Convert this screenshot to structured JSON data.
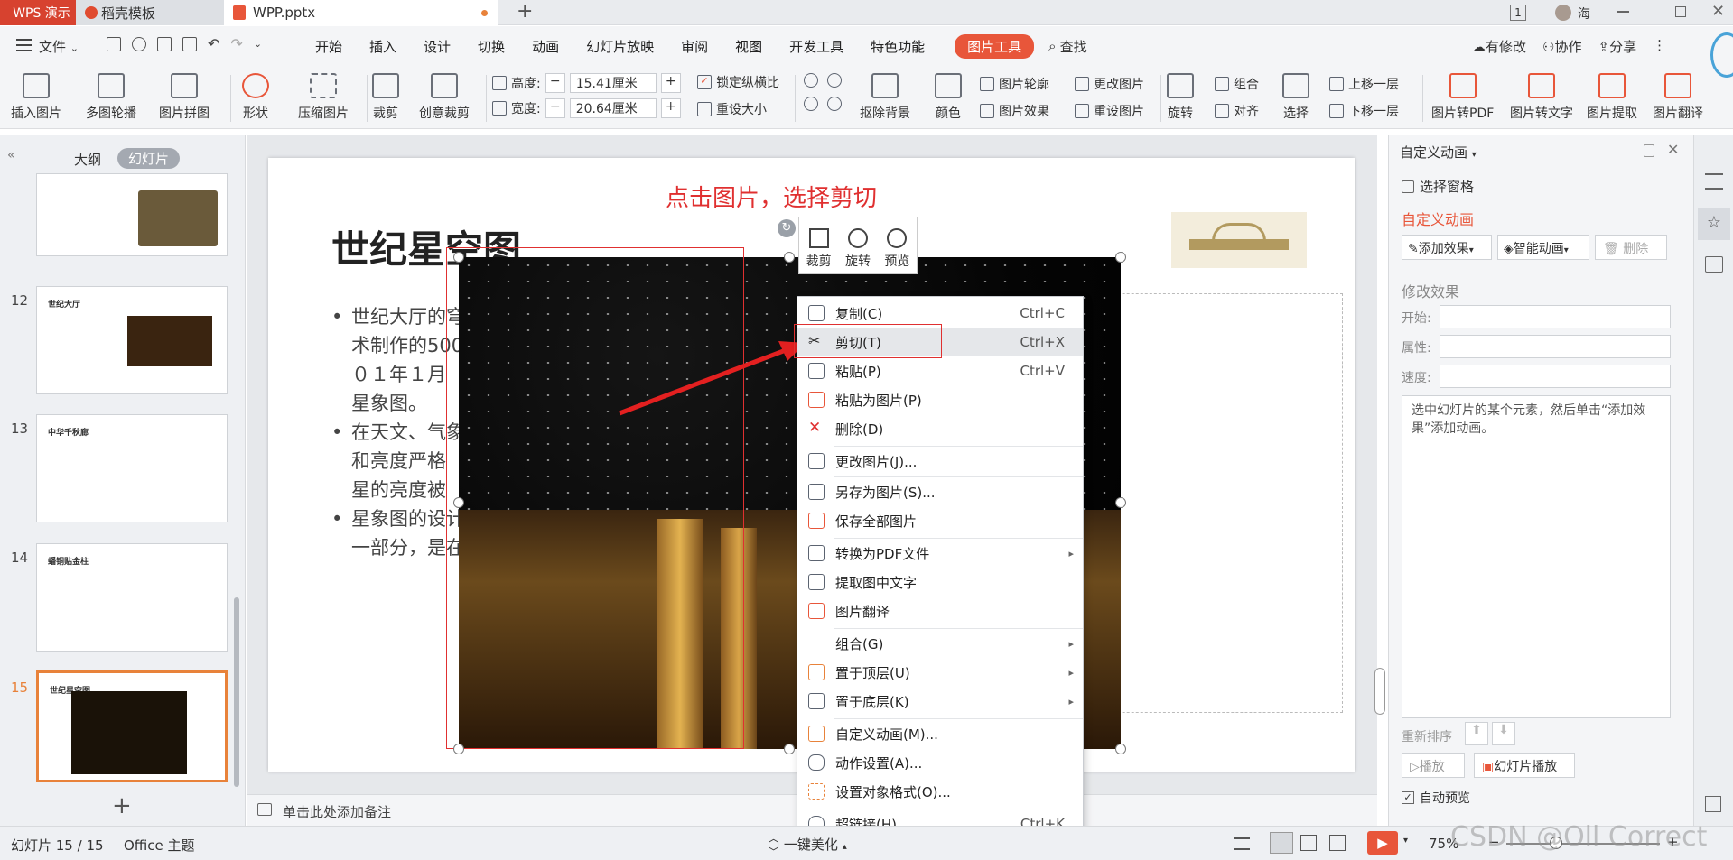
{
  "titlebar": {
    "app_tab": "WPS 演示",
    "tabs": [
      {
        "label": "稻壳模板"
      },
      {
        "label": "WPP.pptx"
      }
    ],
    "page_badge": "1",
    "user_name": "海"
  },
  "menubar": {
    "file": "文件",
    "items": [
      "开始",
      "插入",
      "设计",
      "切换",
      "动画",
      "幻灯片放映",
      "审阅",
      "视图",
      "开发工具",
      "特色功能"
    ],
    "active": "图片工具",
    "search": "查找",
    "right": [
      "有修改",
      "协作",
      "分享"
    ]
  },
  "ribbon": {
    "insert_image": "插入图片",
    "multi_carousel": "多图轮播",
    "image_collage": "图片拼图",
    "shape": "形状",
    "compress": "压缩图片",
    "crop": "裁剪",
    "creative_crop": "创意裁剪",
    "height_label": "高度:",
    "height_value": "15.41厘米",
    "width_label": "宽度:",
    "width_value": "20.64厘米",
    "lock_ratio": "锁定纵横比",
    "reset_size": "重设大小",
    "remove_bg": "抠除背景",
    "color": "颜色",
    "outline": "图片轮廓",
    "effects": "图片效果",
    "change_image": "更改图片",
    "reset_image": "重设图片",
    "rotate": "旋转",
    "group": "组合",
    "align": "对齐",
    "select": "选择",
    "bring_forward": "上移一层",
    "send_backward": "下移一层",
    "to_pdf": "图片转PDF",
    "to_text": "图片转文字",
    "extract": "图片提取",
    "translate": "图片翻译"
  },
  "leftpanel": {
    "tabs": [
      "大纲",
      "幻灯片"
    ],
    "slides": [
      {
        "num": "12",
        "title": "世纪大厅"
      },
      {
        "num": "13",
        "title": "中华千秋廊"
      },
      {
        "num": "14",
        "title": "蟠铜贴金柱"
      },
      {
        "num": "15",
        "title": "世纪星空图"
      }
    ]
  },
  "slide": {
    "annotation": "点击图片，选择剪切",
    "title": "世纪星空图",
    "bullets": [
      {
        "line1": "世纪大厅的穹",
        "line2": "术制作的500",
        "line3": "０１年１月",
        "line4": "星象图。"
      },
      {
        "line1": "在天文、气象",
        "line2": "和亮度严格",
        "line3": "星的亮度被"
      },
      {
        "line1": "星象图的设计",
        "line2": "一部分，是在"
      }
    ],
    "float_toolbar": [
      "裁剪",
      "旋转",
      "预览"
    ]
  },
  "notes_placeholder": "单击此处添加备注",
  "context_menu": {
    "items": [
      {
        "label": "复制(C)",
        "shortcut": "Ctrl+C"
      },
      {
        "label": "剪切(T)",
        "shortcut": "Ctrl+X"
      },
      {
        "label": "粘贴(P)",
        "shortcut": "Ctrl+V"
      },
      {
        "label": "粘贴为图片(P)",
        "shortcut": ""
      },
      {
        "label": "删除(D)",
        "shortcut": ""
      },
      {
        "label": "更改图片(J)...",
        "shortcut": ""
      },
      {
        "label": "另存为图片(S)...",
        "shortcut": ""
      },
      {
        "label": "保存全部图片",
        "shortcut": ""
      },
      {
        "label": "转换为PDF文件",
        "shortcut": ""
      },
      {
        "label": "提取图中文字",
        "shortcut": ""
      },
      {
        "label": "图片翻译",
        "shortcut": ""
      },
      {
        "label": "组合(G)",
        "shortcut": ""
      },
      {
        "label": "置于顶层(U)",
        "shortcut": ""
      },
      {
        "label": "置于底层(K)",
        "shortcut": ""
      },
      {
        "label": "自定义动画(M)...",
        "shortcut": ""
      },
      {
        "label": "动作设置(A)...",
        "shortcut": ""
      },
      {
        "label": "设置对象格式(O)...",
        "shortcut": ""
      },
      {
        "label": "超链接(H)...",
        "shortcut": "Ctrl+K"
      }
    ]
  },
  "rightpanel": {
    "header": "自定义动画",
    "select_pane": "选择窗格",
    "section_title": "自定义动画",
    "add_effect": "添加效果",
    "smart_anim": "智能动画",
    "delete": "删除",
    "modify_title": "修改效果",
    "start_label": "开始:",
    "property_label": "属性:",
    "speed_label": "速度:",
    "hint": "选中幻灯片的某个元素，然后单击“添加效果”添加动画。",
    "reorder": "重新排序",
    "play": "播放",
    "slideshow": "幻灯片播放",
    "auto_preview": "自动预览"
  },
  "statusbar": {
    "slide_info": "幻灯片 15 / 15",
    "theme": "Office 主题",
    "beautify": "一键美化",
    "zoom": "75%",
    "watermark": "CSDN @Oll Correct"
  },
  "colors": {
    "accent": "#d7422f",
    "annotation": "#e03030",
    "tool_active": "#e8563a"
  }
}
